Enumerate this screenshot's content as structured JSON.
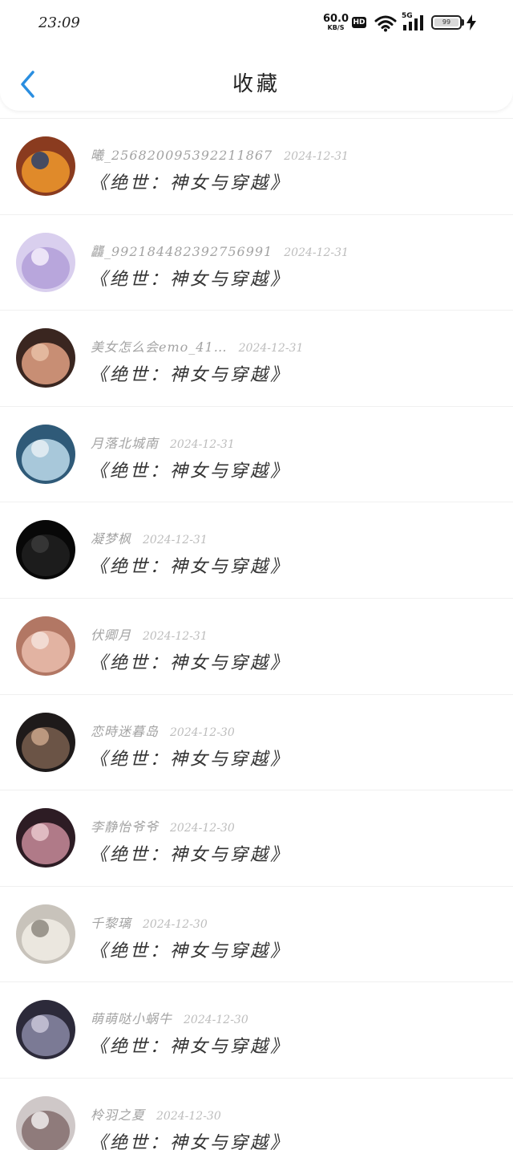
{
  "status_bar": {
    "time": "23:09",
    "net_speed_value": "60.0",
    "net_speed_unit": "KB/S",
    "hd_label": "HD",
    "signal_label": "5G",
    "battery_level": "99"
  },
  "header": {
    "title": "收藏"
  },
  "favorites": [
    {
      "user": "曦_256820095392211867",
      "date": "2024-12-31",
      "title": "《绝世：神女与穿越》",
      "avatar": {
        "bg": "#8a3b1f",
        "mid": "#e08a2a",
        "hi": "#2a3f6b"
      }
    },
    {
      "user": "龘_992184482392756991",
      "date": "2024-12-31",
      "title": "《绝世：神女与穿越》",
      "avatar": {
        "bg": "#d9cfee",
        "mid": "#b8a6dc",
        "hi": "#f4eefc"
      }
    },
    {
      "user": "美女怎么会emo_41…",
      "date": "2024-12-31",
      "title": "《绝世：神女与穿越》",
      "avatar": {
        "bg": "#3a2620",
        "mid": "#c88e74",
        "hi": "#e8c0a6"
      }
    },
    {
      "user": "月落北城南",
      "date": "2024-12-31",
      "title": "《绝世：神女与穿越》",
      "avatar": {
        "bg": "#2f5a78",
        "mid": "#a8c8da",
        "hi": "#e6eef3"
      }
    },
    {
      "user": "凝梦枫",
      "date": "2024-12-31",
      "title": "《绝世：神女与穿越》",
      "avatar": {
        "bg": "#080808",
        "mid": "#1c1c1c",
        "hi": "#3a3a3a"
      }
    },
    {
      "user": "伏卿月",
      "date": "2024-12-31",
      "title": "《绝世：神女与穿越》",
      "avatar": {
        "bg": "#b27764",
        "mid": "#e2b3a2",
        "hi": "#f5e2da"
      }
    },
    {
      "user": "恋時迷暮岛",
      "date": "2024-12-30",
      "title": "《绝世：神女与穿越》",
      "avatar": {
        "bg": "#1e1a1a",
        "mid": "#6b5446",
        "hi": "#c9a58a"
      }
    },
    {
      "user": "李静怡爷爷",
      "date": "2024-12-30",
      "title": "《绝世：神女与穿越》",
      "avatar": {
        "bg": "#2d1c24",
        "mid": "#b07a88",
        "hi": "#e9c7cc"
      }
    },
    {
      "user": "千黎璃",
      "date": "2024-12-30",
      "title": "《绝世：神女与穿越》",
      "avatar": {
        "bg": "#c8c3bb",
        "mid": "#ebe7df",
        "hi": "#8e8880"
      }
    },
    {
      "user": "萌萌哒小蜗牛",
      "date": "2024-12-30",
      "title": "《绝世：神女与穿越》",
      "avatar": {
        "bg": "#2c2a3a",
        "mid": "#7b7a95",
        "hi": "#c9c6d8"
      }
    },
    {
      "user": "柃羽之夏",
      "date": "2024-12-30",
      "title": "《绝世：神女与穿越》",
      "avatar": {
        "bg": "#cfc8c8",
        "mid": "#8f7b7b",
        "hi": "#f0ecec"
      }
    }
  ],
  "colors": {
    "accent_back": "#2a8ee0"
  }
}
